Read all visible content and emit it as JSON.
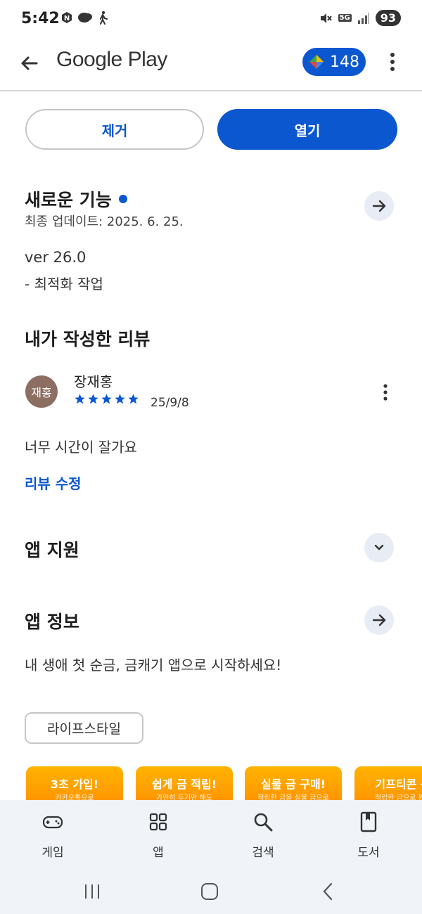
{
  "status_bar": {
    "time": "5:42",
    "network": "5G",
    "battery": "93"
  },
  "app_bar": {
    "title": "Google Play",
    "points": "148"
  },
  "actions": {
    "remove_label": "제거",
    "open_label": "열기"
  },
  "whats_new": {
    "title": "새로운 기능",
    "updated": "최종 업데이트: 2025. 6. 25.",
    "version": "ver 26.0",
    "change": "- 최적화 작업"
  },
  "my_review": {
    "title": "내가 작성한 리뷰",
    "avatar_text": "재홍",
    "reviewer": "장재홍",
    "rating": 5,
    "date": "25/9/8",
    "text": "너무 시간이 잘가요",
    "edit_label": "리뷰 수정"
  },
  "app_support": {
    "title": "앱 지원"
  },
  "app_info": {
    "title": "앱 정보",
    "description": "내 생애 첫 순금, 금캐기 앱으로 시작하세요!",
    "category": "라이프스타일"
  },
  "screenshots": [
    {
      "title": "3초 가입!",
      "sub": "카카오톡으로"
    },
    {
      "title": "쉽게 금 적립!",
      "sub": "가만히 두기만 해도"
    },
    {
      "title": "실물 금 구매!",
      "sub": "적립한 금을 실물 금으로"
    },
    {
      "title": "기프티콘 구",
      "sub": "적립한 금으로 원하"
    }
  ],
  "bottom_nav": [
    {
      "label": "게임",
      "icon": "gamepad-icon"
    },
    {
      "label": "앱",
      "icon": "apps-grid-icon"
    },
    {
      "label": "검색",
      "icon": "search-icon"
    },
    {
      "label": "도서",
      "icon": "book-icon"
    }
  ],
  "colors": {
    "accent": "#0b57d0",
    "nav_bg": "#f0f4f9",
    "circle_btn": "#e8ecf4",
    "avatar": "#8d6e63"
  }
}
